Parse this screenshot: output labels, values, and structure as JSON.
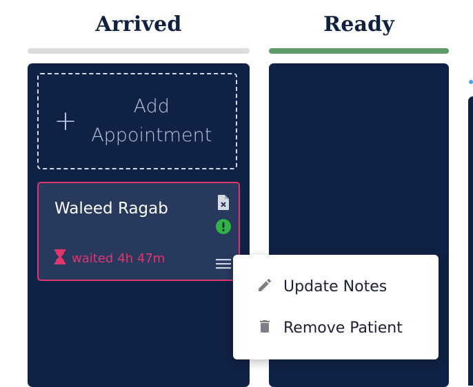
{
  "columns": [
    {
      "title": "Arrived",
      "bar_color": "#dcdcdc"
    },
    {
      "title": "Ready",
      "bar_color": "#5e9a6a"
    }
  ],
  "add_appointment": {
    "plus": "+",
    "label": "Add Appointment"
  },
  "patient_card": {
    "name": "Waleed Ragab",
    "waited_label": "waited",
    "waited_value": "4h 47m",
    "icons": [
      "document-x-icon",
      "alert-icon",
      "menu-icon",
      "hourglass-icon"
    ]
  },
  "context_menu": {
    "items": [
      {
        "label": "Update Notes",
        "icon": "pencil-icon"
      },
      {
        "label": "Remove Patient",
        "icon": "trash-icon"
      }
    ]
  },
  "colors": {
    "navy": "#0f2144",
    "card": "#28395e",
    "accent_pink": "#e2346f",
    "alert_green": "#2fb344"
  }
}
